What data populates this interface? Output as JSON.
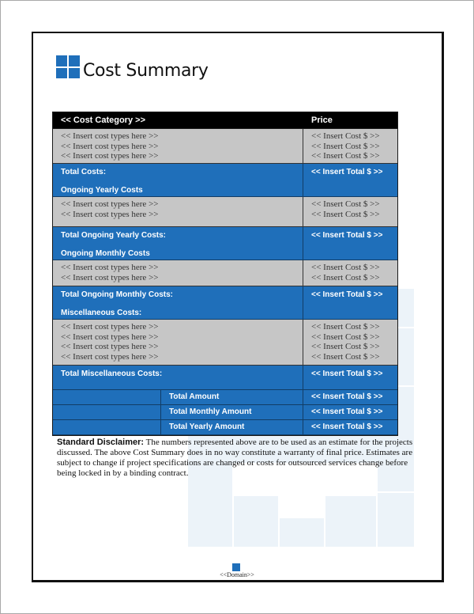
{
  "document": {
    "title": "Cost Summary",
    "footer_domain": "<<Domain>>",
    "colors": {
      "accent_blue": "#1f6fba",
      "header_black": "#000000",
      "row_gray": "#c6c6c6"
    }
  },
  "table": {
    "header": {
      "category": "<< Cost Category >>",
      "price": "Price"
    },
    "sections": [
      {
        "items": [
          {
            "type": "<< Insert cost types here >>",
            "cost": "<< Insert Cost $ >>"
          },
          {
            "type": "<< Insert cost types here >>",
            "cost": "<< Insert Cost $ >>"
          },
          {
            "type": "<< Insert cost types here >>",
            "cost": "<< Insert Cost $ >>"
          }
        ],
        "total_label": "Total Costs:",
        "total_value": "<< Insert Total $ >>",
        "next_heading": "Ongoing Yearly Costs"
      },
      {
        "items": [
          {
            "type": "<< Insert cost types here >>",
            "cost": "<< Insert Cost $ >>"
          },
          {
            "type": "<< Insert cost types here >>",
            "cost": "<< Insert Cost $ >>"
          }
        ],
        "total_label": "Total Ongoing Yearly Costs:",
        "total_value": "<< Insert Total $ >>",
        "next_heading": "Ongoing Monthly Costs"
      },
      {
        "items": [
          {
            "type": "<< Insert cost types here >>",
            "cost": "<< Insert Cost $ >>"
          },
          {
            "type": "<< Insert cost types here >>",
            "cost": "<< Insert Cost $ >>"
          }
        ],
        "total_label": "Total Ongoing Monthly Costs:",
        "total_value": "<< Insert Total $ >>",
        "next_heading": "Miscellaneous Costs:"
      },
      {
        "items": [
          {
            "type": "<< Insert cost types here >>",
            "cost": "<< Insert Cost $ >>"
          },
          {
            "type": "<< Insert cost types here >>",
            "cost": "<< Insert Cost $ >>"
          },
          {
            "type": "<< Insert cost types here >>",
            "cost": "<< Insert Cost $ >>"
          },
          {
            "type": "<< Insert cost types here >>",
            "cost": "<< Insert Cost $ >>"
          }
        ],
        "total_label": "Total Miscellaneous Costs:",
        "total_value": "<< Insert Total $ >>",
        "next_heading": ""
      }
    ],
    "totals": [
      {
        "label": "Total Amount",
        "value": "<< Insert Total $ >>"
      },
      {
        "label": "Total Monthly Amount",
        "value": "<< Insert Total $ >>"
      },
      {
        "label": "Total Yearly Amount",
        "value": "<< Insert Total $ >>"
      }
    ]
  },
  "disclaimer": {
    "label": "Standard Disclaimer:",
    "text": " The numbers represented above are to be used as an estimate for the projects discussed. The above Cost Summary does in no way constitute a warranty of final price.  Estimates are subject to change if project specifications are changed or costs for outsourced services change before being locked in by a binding contract."
  }
}
